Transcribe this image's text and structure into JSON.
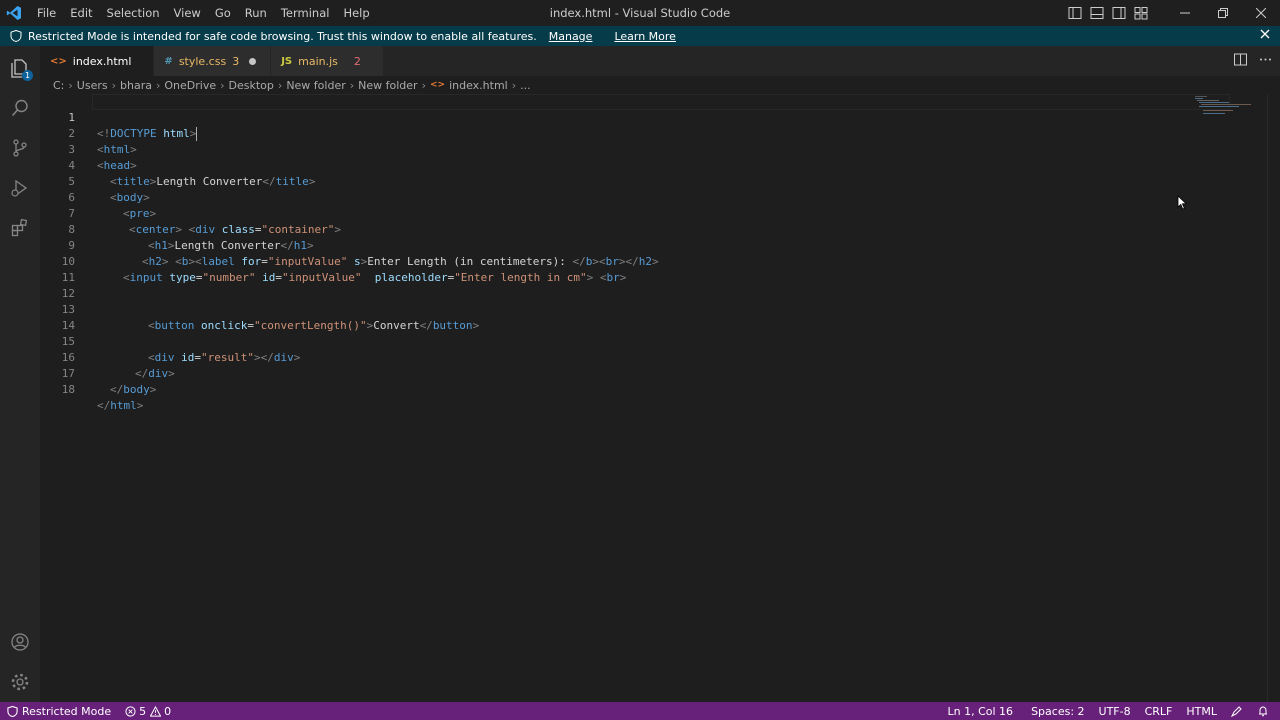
{
  "window": {
    "title": "index.html - Visual Studio Code",
    "menu": [
      "File",
      "Edit",
      "Selection",
      "View",
      "Go",
      "Run",
      "Terminal",
      "Help"
    ]
  },
  "banner": {
    "message": "Restricted Mode is intended for safe code browsing. Trust this window to enable all features.",
    "manage": "Manage",
    "learn_more": "Learn More"
  },
  "activity_badge": "1",
  "tabs": [
    {
      "icon": "<>",
      "label": "index.html",
      "badge": ""
    },
    {
      "icon": "#",
      "label": "style.css",
      "badge": "3"
    },
    {
      "icon": "JS",
      "label": "main.js",
      "badge": "2"
    }
  ],
  "breadcrumb": [
    "C:",
    "Users",
    "bhara",
    "OneDrive",
    "Desktop",
    "New folder",
    "New folder",
    "index.html",
    "..."
  ],
  "code": {
    "line_numbers": [
      "1",
      "2",
      "3",
      "4",
      "5",
      "6",
      "7",
      "8",
      "9",
      "10",
      "11",
      "12",
      "13",
      "14",
      "15",
      "16",
      "17",
      "18"
    ],
    "tokens": {
      "l1": [
        "<!",
        "DOCTYPE",
        " html",
        ">"
      ],
      "l2": [
        "<",
        "html",
        ">"
      ],
      "l3": [
        "<",
        "head",
        ">"
      ],
      "l4": [
        "<",
        "title",
        ">",
        "Length Converter",
        "</",
        "title",
        ">"
      ],
      "l5": [
        "<",
        "body",
        ">"
      ],
      "l6": [
        "<",
        "pre",
        ">"
      ],
      "l7": [
        "<",
        "center",
        ">",
        " ",
        "<",
        "div",
        " class",
        "=",
        "\"container\"",
        ">"
      ],
      "l8": [
        "<",
        "h1",
        ">",
        "Length Converter",
        "</",
        "h1",
        ">"
      ],
      "l9": [
        "<",
        "h2",
        ">",
        " ",
        "<",
        "b",
        ">",
        "<",
        "label",
        " for",
        "=",
        "\"inputValue\"",
        " s",
        ">",
        "Enter Length (in centimeters): ",
        "</",
        "b",
        ">",
        "<",
        "br",
        ">",
        "</",
        "h2",
        ">"
      ],
      "l10": [
        "<",
        "input",
        " type",
        "=",
        "\"number\"",
        " id",
        "=",
        "\"inputValue\"",
        "  placeholder",
        "=",
        "\"Enter length in cm\"",
        ">",
        " ",
        "<",
        "br",
        ">"
      ],
      "l13": [
        "<",
        "button",
        " onclick",
        "=",
        "\"convertLength()\"",
        ">",
        "Convert",
        "</",
        "button",
        ">"
      ],
      "l15": [
        "<",
        "div",
        " id",
        "=",
        "\"result\"",
        ">",
        "</",
        "div",
        ">"
      ],
      "l16": [
        "</",
        "div",
        ">"
      ],
      "l17": [
        "</",
        "body",
        ">"
      ],
      "l18": [
        "</",
        "html",
        ">"
      ]
    }
  },
  "status": {
    "mode": "Restricted Mode",
    "errors": "5",
    "warnings": "0",
    "position": "Ln 1, Col 16",
    "spaces": "Spaces: 2",
    "encoding": "UTF-8",
    "eol": "CRLF",
    "language": "HTML"
  },
  "colors": {
    "title_bar": "#1f1f1f",
    "banner": "#063b49",
    "status_bar": "#68217a",
    "editor_bg": "#1e1e1e",
    "tag": "#569cd6",
    "attribute": "#9cdcfe",
    "string": "#ce9178"
  }
}
